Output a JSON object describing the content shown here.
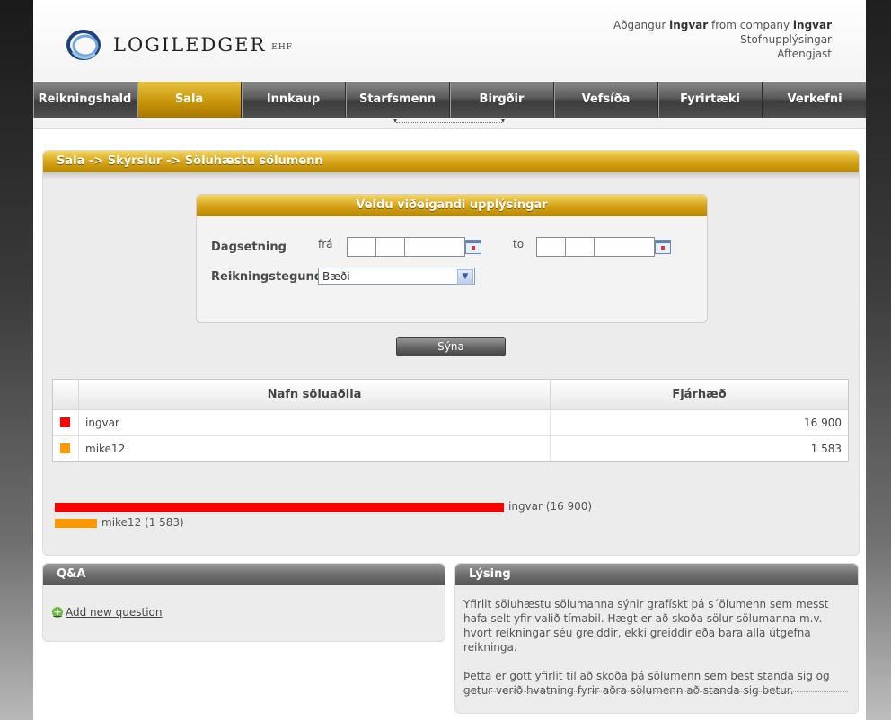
{
  "header": {
    "logo_text": "LOGILEDGER",
    "logo_suffix": "EHF",
    "user_prefix": "Aðgangur",
    "user_name": "ingvar",
    "user_mid": "from company",
    "company": "ingvar",
    "profile_link": "Stofnupplýsingar",
    "logout_link": "Aftengjast"
  },
  "nav": {
    "items": [
      {
        "label": "Reikningshald"
      },
      {
        "label": "Sala"
      },
      {
        "label": "Innkaup"
      },
      {
        "label": "Starfsmenn"
      },
      {
        "label": "Birgðir"
      },
      {
        "label": "Vefsíða"
      },
      {
        "label": "Fyrirtæki"
      },
      {
        "label": "Verkefni"
      }
    ],
    "active": "Sala"
  },
  "breadcrumb": "Sala -> Skýrslur -> Söluhæstu sölumenn",
  "filter": {
    "title": "Veldu viðeigandi upplýsingar",
    "date_label": "Dagsetning",
    "from_label": "frá",
    "to_label": "to",
    "type_label": "Reikningstegund",
    "type_value": "Bæði",
    "show_button": "Sýna"
  },
  "table": {
    "col_name": "Nafn söluaðila",
    "col_amount": "Fjárhæð",
    "rows": [
      {
        "name": "ingvar",
        "amount": "16 900",
        "color": "#ff0000"
      },
      {
        "name": "mike12",
        "amount": "1 583",
        "color": "#ff9900"
      }
    ]
  },
  "bars": [
    {
      "label": "ingvar (16 900)",
      "value": 16900,
      "color": "#ff0000"
    },
    {
      "label": "mike12 (1 583)",
      "value": 1583,
      "color": "#ff9900"
    }
  ],
  "qa": {
    "title": "Q&A",
    "add_link": "Add new question"
  },
  "description": {
    "title": "Lýsing",
    "p1": "Yfirlit söluhæstu sölumanna sýnir grafískt þá s´ölumenn sem messt hafa selt yfir valið tímabil. Hægt er að skoða sölur sölumanna m.v. hvort reikningar séu greiddir, ekki greiddir eða bara alla útgefna reikninga.",
    "p2": "Þetta er gott yfirlit til að skoða þá sölumenn sem best standa sig og getur verið hvatning fyrir aðra sölumenn að standa sig betur."
  }
}
